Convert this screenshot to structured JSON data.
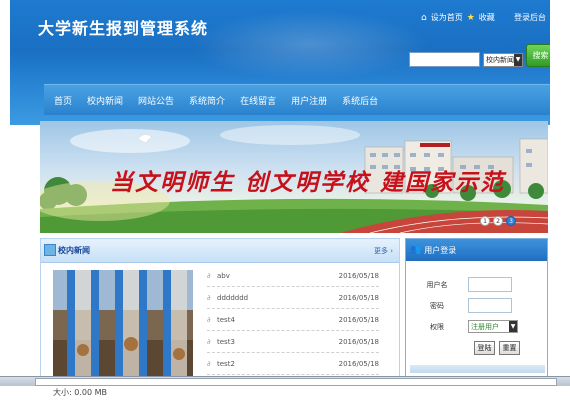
{
  "header": {
    "site_title": "大学新生报到管理系统",
    "top_links": [
      "设为首页",
      "收藏",
      "登录后台"
    ]
  },
  "search": {
    "placeholder": "",
    "category_selected": "校内新闻",
    "button_label": "搜索"
  },
  "nav": {
    "items": [
      "首页",
      "校内新闻",
      "网站公告",
      "系统简介",
      "在线留言",
      "用户注册",
      "系统后台"
    ]
  },
  "banner": {
    "slogan": "当文明师生 创文明学校 建国家示范",
    "slides": [
      "1",
      "2",
      "3"
    ],
    "active_slide": 3
  },
  "news": {
    "title": "校内新闻",
    "more_label": "更多 ›",
    "items": [
      {
        "title": "abv",
        "date": "2016/05/18"
      },
      {
        "title": "ddddddd",
        "date": "2016/05/18"
      },
      {
        "title": "test4",
        "date": "2016/05/18"
      },
      {
        "title": "test3",
        "date": "2016/05/18"
      },
      {
        "title": "test2",
        "date": "2016/05/18"
      }
    ]
  },
  "login": {
    "title": "用户登录",
    "username_label": "用户名",
    "password_label": "密码",
    "role_label": "权限",
    "role_selected": "注册用户",
    "login_button": "登陆",
    "reset_button": "重置"
  },
  "status": {
    "file_info": "大小: 0.00 MB"
  },
  "colors": {
    "header_blue": "#1a6fc2",
    "nav_blue": "#2a82cf",
    "search_green": "#2f9c23",
    "slogan_red": "#c8101a"
  }
}
